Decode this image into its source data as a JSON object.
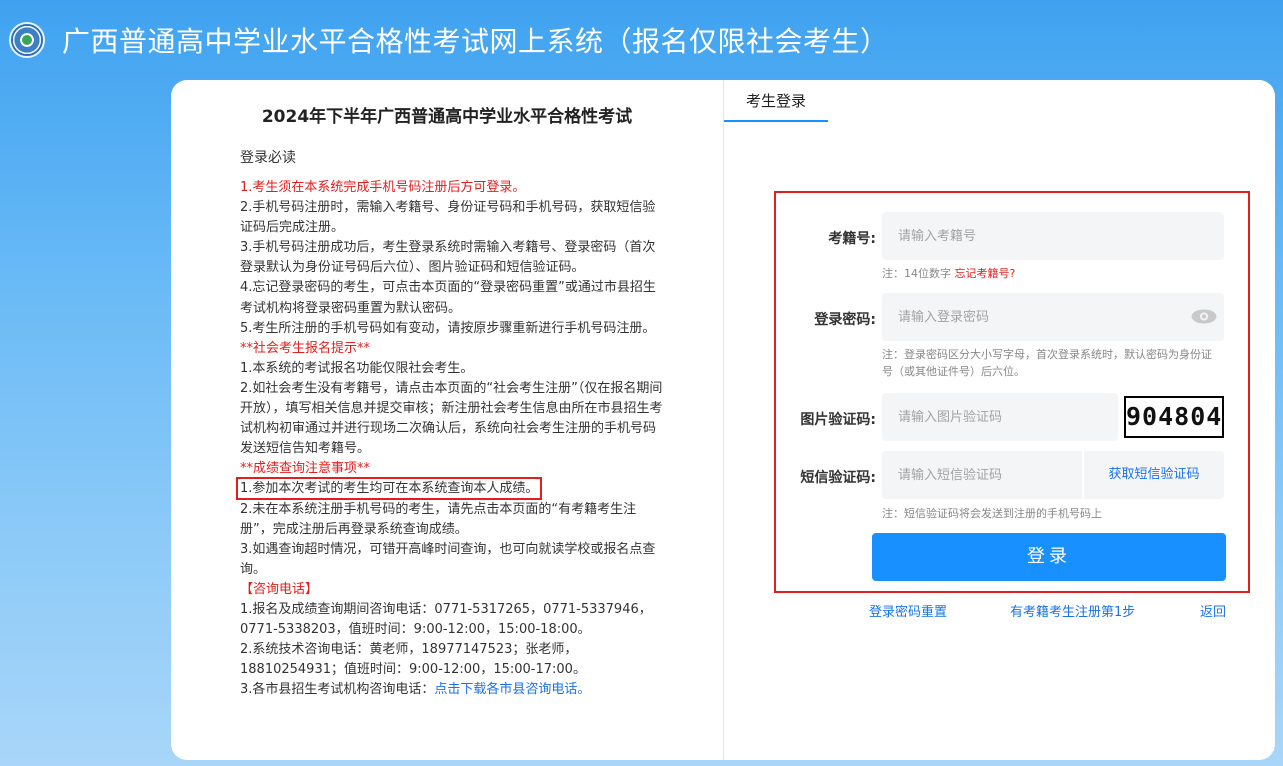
{
  "header": {
    "title": "广西普通高中学业水平合格性考试网上系统（报名仅限社会考生）"
  },
  "notice": {
    "title": "2024年下半年广西普通高中学业水平合格性考试",
    "subtitle": "登录必读",
    "lines": [
      "1.考生须在本系统完成手机号码注册后方可登录。",
      "2.手机号码注册时，需输入考籍号、身份证号码和手机号码，获取短信验证码后完成注册。",
      "3.手机号码注册成功后，考生登录系统时需输入考籍号、登录密码（首次登录默认为身份证号码后六位）、图片验证码和短信验证码。",
      "4.忘记登录密码的考生，可点击本页面的“登录密码重置”或通过市县招生考试机构将登录密码重置为默认密码。",
      "5.考生所注册的手机号码如有变动，请按原步骤重新进行手机号码注册。",
      "**社会考生报名提示**",
      "1.本系统的考试报名功能仅限社会考生。",
      "2.如社会考生没有考籍号，请点击本页面的“社会考生注册”（仅在报名期间开放），填写相关信息并提交审核；新注册社会考生信息由所在市县招生考试机构初审通过并进行现场二次确认后，系统向社会考生注册的手机号码发送短信告知考籍号。",
      "**成绩查询注意事项**",
      "1.参加本次考试的考生均可在本系统查询本人成绩。",
      "2.未在本系统注册手机号码的考生，请先点击本页面的“有考籍考生注册”，完成注册后再登录系统查询成绩。",
      "3.如遇查询超时情况，可错开高峰时间查询，也可向就读学校或报名点查询。",
      "【咨询电话】",
      "1.报名及成绩查询期间咨询电话：0771-5317265，0771-5337946，0771-5338203，值班时间：9:00-12:00，15:00-18:00。",
      "2.系统技术咨询电话：黄老师，18977147523；张老师，18810254931；值班时间：9:00-12:00，15:00-17:00。",
      "3.各市县招生考试机构咨询电话："
    ],
    "download_link": "点击下载各市县咨询电话。"
  },
  "login": {
    "tab_label": "考生登录",
    "exam_id_label": "考籍号:",
    "exam_id_placeholder": "请输入考籍号",
    "exam_id_hint": "注：14位数字",
    "forgot_exam_id": "忘记考籍号?",
    "password_label": "登录密码:",
    "password_placeholder": "请输入登录密码",
    "password_hint": "注：登录密码区分大小写字母，首次登录系统时，默认密码为身份证号（或其他证件号）后六位。",
    "captcha_label": "图片验证码:",
    "captcha_placeholder": "请输入图片验证码",
    "captcha_text": "904804",
    "sms_label": "短信验证码:",
    "sms_placeholder": "请输入短信验证码",
    "sms_button": "获取短信验证码",
    "sms_hint": "注：短信验证码将会发送到注册的手机号码上",
    "submit": "登录"
  },
  "links": {
    "reset_password": "登录密码重置",
    "register": "有考籍考生注册第1步",
    "back": "返回"
  },
  "colors": {
    "accent": "#1890ff",
    "warning": "#e02020"
  }
}
